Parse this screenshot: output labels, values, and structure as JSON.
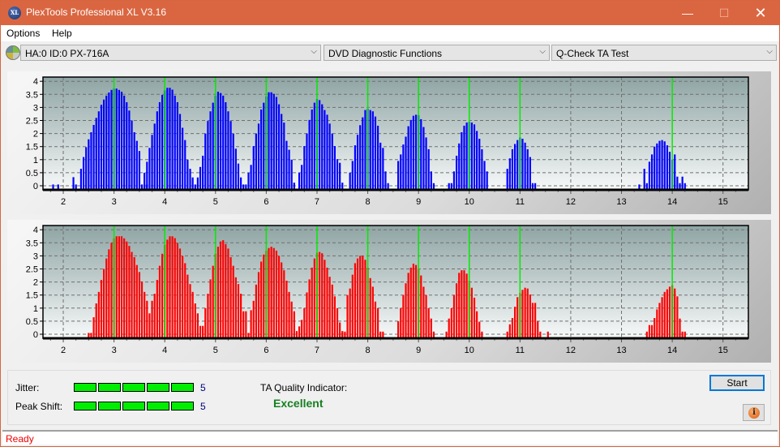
{
  "window": {
    "title": "PlexTools Professional XL V3.16",
    "logo_text": "XL",
    "controls": {
      "minimize": "—",
      "maximize": "☐",
      "close": "✕"
    }
  },
  "menu": {
    "items": [
      "Options",
      "Help"
    ]
  },
  "toolbar": {
    "drive": "HA:0 ID:0  PX-716A",
    "function": "DVD Diagnostic Functions",
    "test": "Q-Check TA Test",
    "chevron": "⌵"
  },
  "colors": {
    "upper_bars": "#0000ff",
    "lower_bars": "#ff0000",
    "marker_lines": "#00ee00",
    "meter_segment": "#00ee00",
    "quality_text": "#15801f",
    "status_text": "#ee0000",
    "titlebar": "#da6641"
  },
  "chart_data": [
    {
      "type": "bar",
      "name": "upper-ta-histogram",
      "series": "lands/pits (upper)",
      "color": "#0000ff",
      "xlim": [
        1.6,
        15.5
      ],
      "ylim": [
        0,
        4.2
      ],
      "x_ticks": [
        2,
        3,
        4,
        5,
        6,
        7,
        8,
        9,
        10,
        11,
        12,
        13,
        14,
        15
      ],
      "y_ticks": [
        0,
        0.5,
        1,
        1.5,
        2,
        2.5,
        3,
        3.5,
        4
      ],
      "y_tick_labels": [
        "0",
        "0.5",
        "1",
        "1.5",
        "2",
        "2.5",
        "3",
        "3.5",
        "4"
      ],
      "marker_lines_x": [
        3,
        4,
        5,
        6,
        7,
        8,
        9,
        10,
        11,
        14
      ],
      "grid": true,
      "bar_step": 0.05,
      "clusters": [
        {
          "start": 1.8,
          "values": [
            0.05,
            0,
            0.05
          ]
        },
        {
          "start": 2.2,
          "values": [
            0.33,
            0.05,
            0,
            0.65,
            1.1,
            1.48,
            1.78,
            2.05,
            2.33,
            2.6,
            2.85,
            3.1,
            3.3,
            3.45,
            3.57,
            3.67,
            3.72,
            3.72,
            3.67,
            3.6,
            3.45,
            3.2,
            2.88,
            2.5,
            2.05,
            1.72,
            1.33,
            0.05,
            0.05,
            0.05
          ]
        },
        {
          "start": 3.6,
          "values": [
            0.5,
            0.92,
            1.45,
            1.95,
            2.38,
            2.85,
            3.2,
            3.48,
            3.65,
            3.75,
            3.75,
            3.68,
            3.45,
            3.2,
            2.75,
            2.22,
            1.75,
            1.0,
            0.65,
            0.32
          ]
        },
        {
          "start": 4.6,
          "values": [
            0.05,
            0.32,
            0.72,
            1.15,
            2.0,
            2.48,
            2.85,
            3.18,
            3.45,
            3.6,
            3.55,
            3.45,
            3.2,
            2.85,
            2.48,
            2.0,
            1.42,
            0.85,
            0.32,
            0.05,
            0.05
          ]
        },
        {
          "start": 5.65,
          "values": [
            0.5,
            0.8,
            1.52,
            2.0,
            2.38,
            2.92,
            3.18,
            3.42,
            3.58,
            3.58,
            3.52,
            3.4,
            3.12,
            2.75,
            2.42,
            1.72,
            1.38,
            1.0,
            0.12
          ]
        },
        {
          "start": 6.65,
          "values": [
            0.5,
            0.8,
            1.52,
            2.0,
            2.52,
            2.92,
            3.18,
            3.32,
            3.28,
            3.12,
            2.9,
            2.72,
            2.38,
            2.0,
            1.52,
            1.02,
            0.88,
            0.12
          ]
        },
        {
          "start": 7.65,
          "values": [
            0.5,
            0.95,
            1.55,
            1.95,
            2.32,
            2.62,
            2.9,
            2.95,
            2.9,
            2.85,
            2.65,
            2.3,
            1.65,
            1.45,
            0.55,
            0.1
          ]
        },
        {
          "start": 8.6,
          "values": [
            0.95,
            1.2,
            1.58,
            1.88,
            2.28,
            2.52,
            2.68,
            2.72,
            2.7,
            2.55,
            2.25,
            1.85,
            1.4,
            0.55,
            0.1
          ]
        },
        {
          "start": 9.6,
          "values": [
            0.1,
            0.1,
            0.55,
            1.15,
            1.62,
            2.05,
            2.3,
            2.42,
            2.45,
            2.42,
            2.35,
            2.1,
            1.8,
            1.4,
            0.95,
            0.55
          ]
        },
        {
          "start": 10.75,
          "values": [
            0.65,
            1.05,
            1.4,
            1.6,
            1.75,
            1.85,
            1.8,
            1.65,
            1.4,
            1.1,
            0.1,
            0.1
          ]
        },
        {
          "start": 13.35,
          "values": [
            0.05,
            0,
            0.65,
            0.1,
            0.92,
            1.2,
            1.5,
            1.62,
            1.72,
            1.75,
            1.7,
            1.55,
            1.3,
            1.0,
            1.2,
            0.35,
            0.1,
            0.35,
            0.1
          ]
        }
      ]
    },
    {
      "type": "bar",
      "name": "lower-ta-histogram",
      "series": "lands/pits (lower)",
      "color": "#ff0000",
      "xlim": [
        1.6,
        15.5
      ],
      "ylim": [
        0,
        4.2
      ],
      "x_ticks": [
        2,
        3,
        4,
        5,
        6,
        7,
        8,
        9,
        10,
        11,
        12,
        13,
        14,
        15
      ],
      "y_ticks": [
        0,
        0.5,
        1,
        1.5,
        2,
        2.5,
        3,
        3.5,
        4
      ],
      "y_tick_labels": [
        "0",
        "0.5",
        "1",
        "1.5",
        "2",
        "2.5",
        "3",
        "3.5",
        "4"
      ],
      "marker_lines_x": [
        3,
        4,
        5,
        6,
        7,
        8,
        9,
        10,
        11,
        14
      ],
      "grid": true,
      "bar_step": 0.05,
      "clusters": [
        {
          "start": 2.5,
          "values": [
            0.05,
            0.05,
            0.65,
            1.18,
            1.62,
            2.08,
            2.5,
            2.9,
            3.25,
            3.5,
            3.67,
            3.75,
            3.75,
            3.75,
            3.67,
            3.55,
            3.38,
            3.15,
            2.95,
            2.65,
            2.38,
            2.02,
            1.62,
            1.28,
            0.8,
            1.28,
            1.55,
            2.08,
            2.62,
            3.08,
            3.42,
            3.62,
            3.75,
            3.75,
            3.68,
            3.5,
            3.28,
            3.0,
            2.72,
            2.28,
            1.92,
            1.62,
            1.18,
            0.8,
            0.32,
            0.32,
            1.0,
            1.55,
            2.1,
            2.62,
            3.08,
            3.35,
            3.55,
            3.6,
            3.45,
            3.28,
            2.95,
            2.62,
            2.18,
            1.92,
            1.55,
            0.88,
            0.88,
            0.05
          ]
        },
        {
          "start": 5.7,
          "values": [
            0.92,
            1.28,
            1.9,
            2.38,
            2.78,
            3.05,
            3.2,
            3.3,
            3.35,
            3.3,
            3.2,
            3.0,
            2.75,
            2.45,
            2.05,
            1.62,
            1.25,
            0.88,
            0.12,
            0.3,
            0.55,
            1.0,
            1.6,
            2.1,
            2.55,
            2.9,
            3.12,
            3.15,
            3.1,
            2.85,
            2.55,
            2.2,
            1.9,
            1.45,
            1.0,
            0.45,
            0.1
          ]
        },
        {
          "start": 7.5,
          "values": [
            0.12,
            0.1,
            1.5,
            1.75,
            2.28,
            2.72,
            2.9,
            3.0,
            3.0,
            2.85,
            2.55,
            2.15,
            1.82,
            1.25,
            1.0,
            0.1,
            0.1
          ]
        },
        {
          "start": 8.6,
          "values": [
            0.5,
            1.0,
            1.5,
            1.95,
            2.35,
            2.55,
            2.7,
            2.65,
            2.5,
            2.25,
            1.82,
            1.5,
            1.0,
            0.6,
            0.1
          ]
        },
        {
          "start": 9.55,
          "values": [
            0.1,
            0.6,
            1.0,
            1.5,
            1.95,
            2.35,
            2.45,
            2.45,
            2.32,
            2.05,
            1.78,
            1.4,
            0.88,
            0.48,
            0.1
          ]
        },
        {
          "start": 10.75,
          "values": [
            0.1,
            0.38,
            0.62,
            1.05,
            1.42,
            1.58,
            1.7,
            1.78,
            1.75,
            1.52,
            1.2,
            1.2,
            0.5,
            0.1,
            0,
            0,
            0.1
          ]
        },
        {
          "start": 13.5,
          "values": [
            0.1,
            0.35,
            0.35,
            0.62,
            0.95,
            1.2,
            1.42,
            1.62,
            1.72,
            1.82,
            1.88,
            1.75,
            1.45,
            0.6,
            0.1,
            0.1
          ]
        }
      ]
    }
  ],
  "metrics": {
    "jitter": {
      "label": "Jitter:",
      "value": "5",
      "segments_filled": 5,
      "segments_total": 5
    },
    "peak_shift": {
      "label": "Peak Shift:",
      "value": "5",
      "segments_filled": 5,
      "segments_total": 5
    },
    "ta_quality": {
      "label": "TA Quality Indicator:",
      "value": "Excellent"
    }
  },
  "buttons": {
    "start": "Start",
    "info_icon": "i"
  },
  "status": {
    "text": "Ready"
  }
}
